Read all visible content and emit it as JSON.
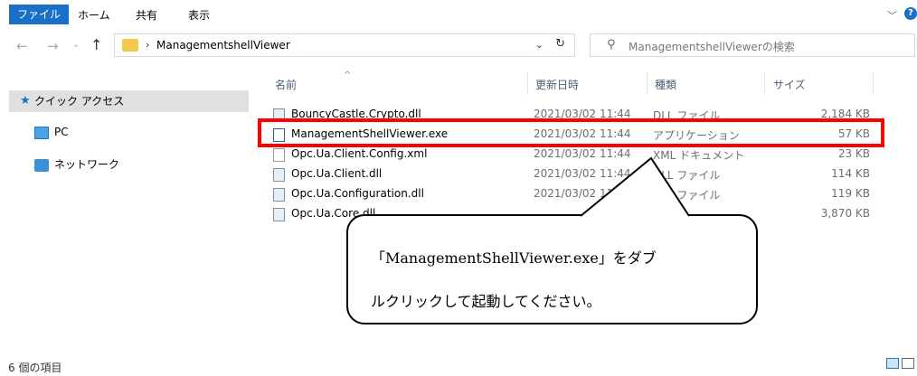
{
  "ribbon": {
    "tabs": [
      "ファイル",
      "ホーム",
      "共有",
      "表示"
    ],
    "expand_icon": "chevron-down-icon",
    "help_icon": "help-icon"
  },
  "address": {
    "path": "ManagementshellViewer",
    "search_placeholder": "ManagementshellViewerの検索"
  },
  "sidebar": {
    "items": [
      "クイック アクセス",
      "PC",
      "ネットワーク"
    ]
  },
  "columns": {
    "name": "名前",
    "date": "更新日時",
    "type": "種類",
    "size": "サイズ"
  },
  "files": [
    {
      "name": "BouncyCastle.Crypto.dll",
      "date": "2021/03/02 11:44",
      "type": "DLL ファイル",
      "size": "2,184 KB"
    },
    {
      "name": "ManagementShellViewer.exe",
      "date": "2021/03/02 11:44",
      "type": "アプリケーション",
      "size": "57 KB"
    },
    {
      "name": "Opc.Ua.Client.Config.xml",
      "date": "2021/03/02 11:44",
      "type": "XML ドキュメント",
      "size": "23 KB"
    },
    {
      "name": "Opc.Ua.Client.dll",
      "date": "2021/03/02 11:44",
      "type": "DLL ファイル",
      "size": "114 KB"
    },
    {
      "name": "Opc.Ua.Configuration.dll",
      "date": "2021/03/02 11:44",
      "type": "DLL ファイル",
      "size": "119 KB"
    },
    {
      "name": "Opc.Ua.Core.dll",
      "date": "",
      "type": "",
      "size": "3,870 KB"
    }
  ],
  "callout": {
    "line1": "「ManagementShellViewer.exe」をダブ",
    "line2": "ルクリックして起動してください。"
  },
  "status": {
    "item_count": "6 個の項目"
  },
  "colors": {
    "accent": "#1a6fc9",
    "highlight": "#ff0000"
  }
}
